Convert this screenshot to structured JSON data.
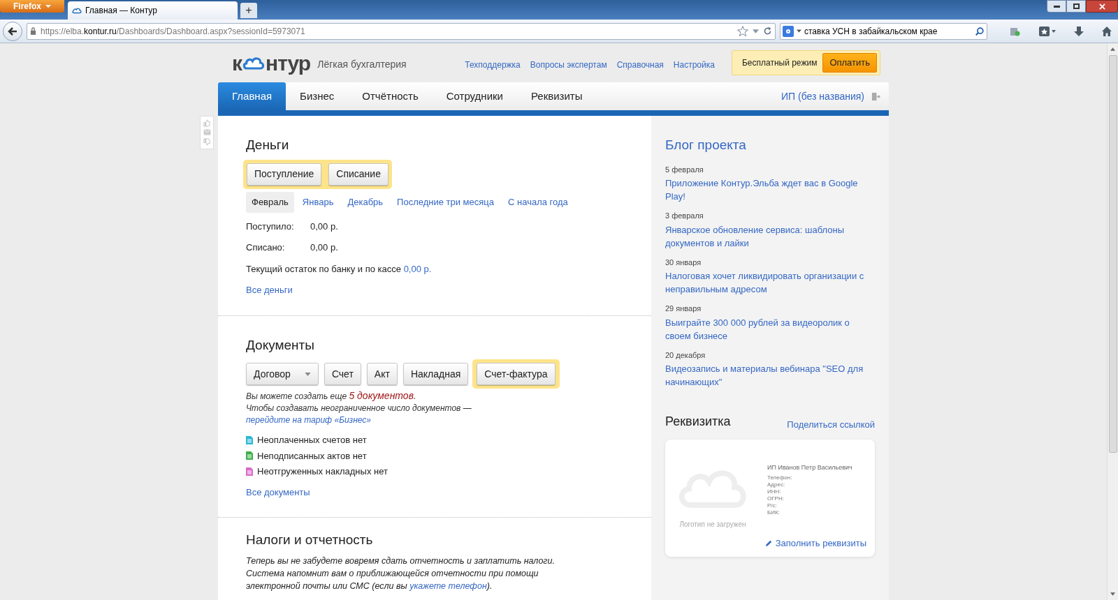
{
  "browser": {
    "menu_button": "Firefox",
    "tab_title": "Главная — Контур",
    "new_tab": "+",
    "url_prefix": "https://elba.",
    "url_host": "kontur.ru",
    "url_rest": "/Dashboards/Dashboard.aspx?sessionId=5973071",
    "search_value": "ставка УСН в забайкальском крае"
  },
  "header": {
    "logo_left": "к",
    "logo_right": "нтур",
    "tagline": "Лёгкая бухгалтерия",
    "links": [
      "Техподдержка",
      "Вопросы экспертам",
      "Справочная",
      "Настройка"
    ],
    "plan": "Бесплатный режим",
    "pay_button": "Оплатить"
  },
  "nav": {
    "tabs": [
      {
        "label": "Главная",
        "selected": true
      },
      {
        "label": "Бизнес",
        "selected": false
      },
      {
        "label": "Отчётность",
        "selected": false
      },
      {
        "label": "Сотрудники",
        "selected": false
      },
      {
        "label": "Реквизиты",
        "selected": false
      }
    ],
    "account": "ИП (без названия)"
  },
  "money": {
    "title": "Деньги",
    "buttons_highlighted": true,
    "buttons": [
      "Поступление",
      "Списание"
    ],
    "periods": [
      {
        "label": "Февраль",
        "selected": true
      },
      {
        "label": "Январь",
        "selected": false
      },
      {
        "label": "Декабрь",
        "selected": false
      },
      {
        "label": "Последние три месяца",
        "selected": false
      },
      {
        "label": "С начала года",
        "selected": false
      }
    ],
    "rows": [
      {
        "label": "Поступило:",
        "value": "0,00 р."
      },
      {
        "label": "Списано:",
        "value": "0,00 р."
      }
    ],
    "balance_text": "Текущий остаток по банку и по кассе",
    "balance_link": "0,00 р.",
    "all_link": "Все деньги"
  },
  "documents": {
    "title": "Документы",
    "buttons": [
      {
        "label": "Договор",
        "kind": "dropdown",
        "highlighted": false
      },
      {
        "label": "Счет",
        "kind": "plain",
        "highlighted": false
      },
      {
        "label": "Акт",
        "kind": "plain",
        "highlighted": false
      },
      {
        "label": "Накладная",
        "kind": "plain",
        "highlighted": false
      },
      {
        "label": "Счет-фактура",
        "kind": "plain",
        "highlighted": true
      }
    ],
    "limit_prefix": "Вы можете создать еще",
    "limit_count": "5 документов",
    "limit_suffix": ".",
    "upgrade_text": "Чтобы создавать неограниченное число документов —",
    "upgrade_link": "перейдите на тариф «Бизнес»",
    "statuses": [
      {
        "text": "Неоплаченных счетов нет",
        "color": "#2ab7d6"
      },
      {
        "text": "Неподписанных актов нет",
        "color": "#3fae49"
      },
      {
        "text": "Неотгруженных накладных нет",
        "color": "#d96bc9"
      }
    ],
    "all_link": "Все документы"
  },
  "taxes": {
    "title": "Налоги и отчетность",
    "text": "Теперь вы не забудете вовремя сдать отчетность и заплатить налоги. Система напомнит вам о приближающейся отчетности при помощи электронной почты или СМС (если вы",
    "link": "укажете телефон",
    "text_end": ")."
  },
  "blog": {
    "title": "Блог проекта",
    "posts": [
      {
        "date": "5 февраля",
        "title": "Приложение Контур.Эльба ждет вас в Google Play!"
      },
      {
        "date": "3 февраля",
        "title": "Январское обновление сервиса: шаблоны документов и лайки"
      },
      {
        "date": "30 января",
        "title": "Налоговая хочет ликвидировать организации с неправильным адресом"
      },
      {
        "date": "29 января",
        "title": "Выиграйте 300 000 рублей за видеоролик о своем бизнесе"
      },
      {
        "date": "20 декабря",
        "title": "Видеозапись и материалы вебинара \"SEO для начинающих\""
      }
    ]
  },
  "card": {
    "title": "Реквизитка",
    "share_link": "Поделиться ссылкой",
    "logo_note": "Логотип не загружен",
    "name": "ИП Иванов Петр Васильевич",
    "fields": [
      "Телефон:",
      "Адрес:",
      "ИНН:",
      "ОГРН:",
      "Р/с:",
      "БИК:"
    ],
    "fill_link": "Заполнить реквизиты"
  }
}
